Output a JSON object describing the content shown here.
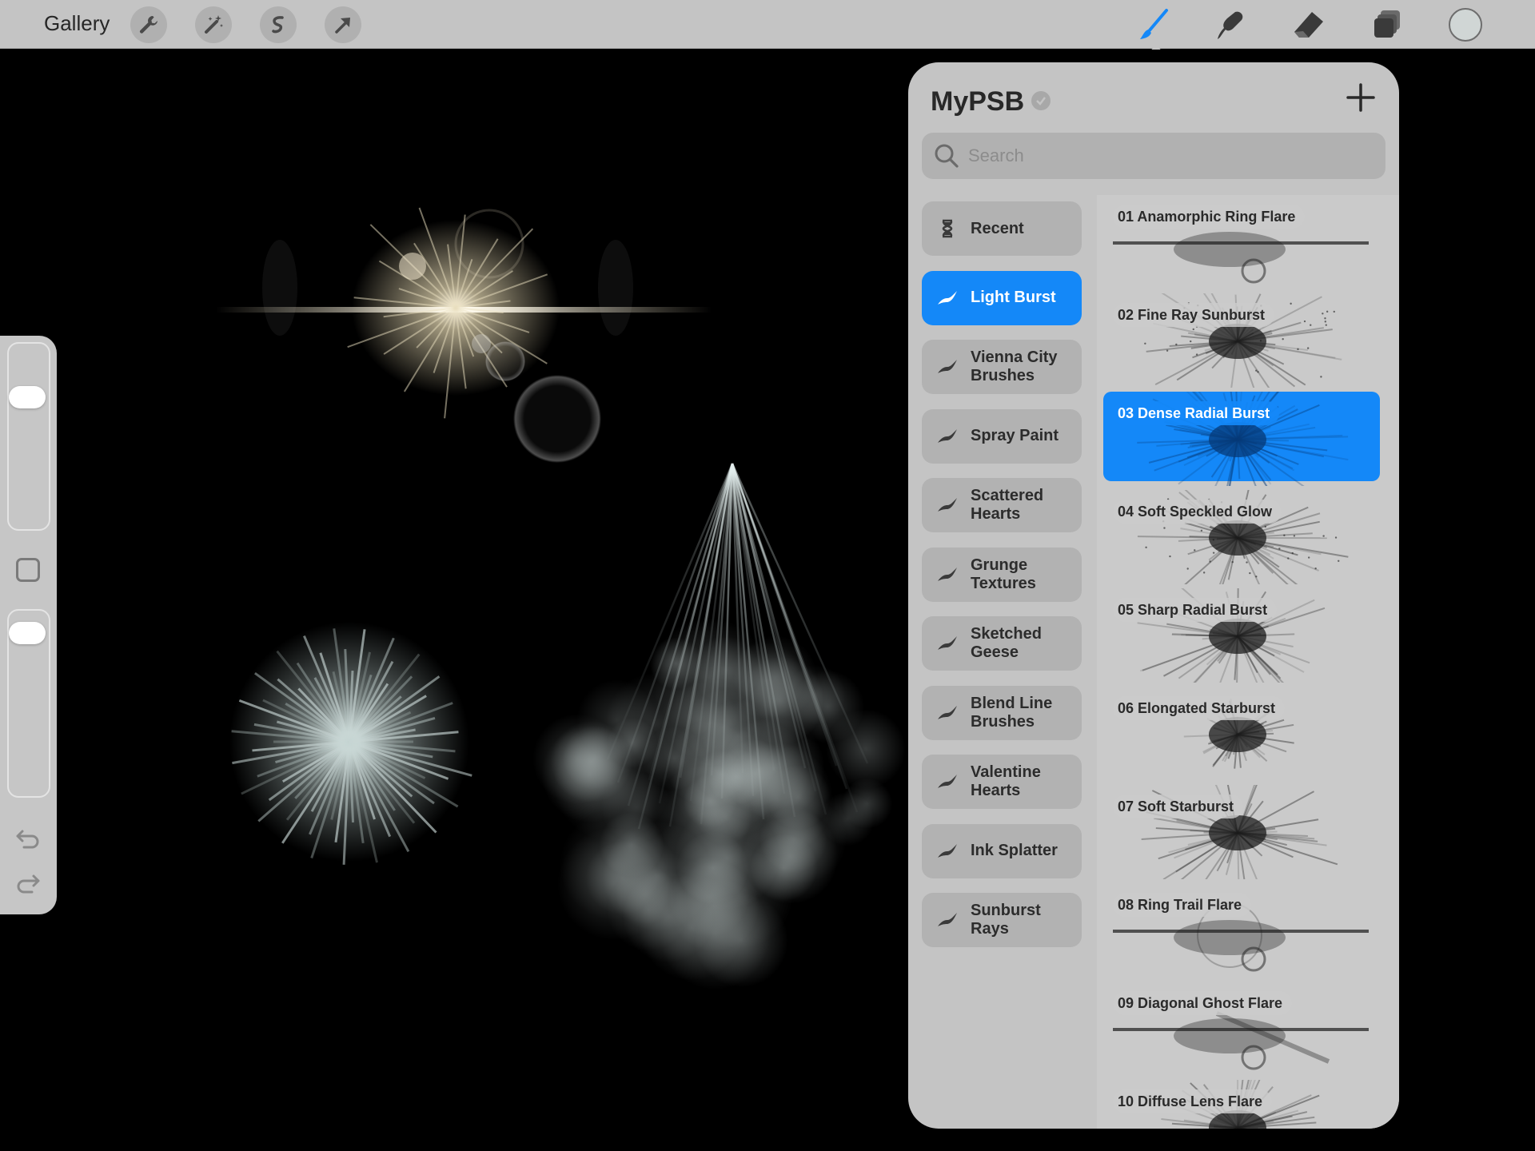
{
  "topbar": {
    "gallery_label": "Gallery",
    "left_tools": [
      "wrench-icon",
      "magic-wand-icon",
      "selection-icon",
      "transform-arrow-icon"
    ],
    "right_tools": [
      "brush-icon",
      "smudge-icon",
      "eraser-icon",
      "layers-icon"
    ],
    "active_tool": "brush-icon",
    "current_color": "#d0d6d5"
  },
  "sidebar": {
    "brush_size_level": 0.75,
    "opacity_level": 0.95
  },
  "library": {
    "title": "MyPSB",
    "search_placeholder": "Search",
    "sets": [
      {
        "label": "Recent",
        "icon": "hourglass-icon"
      },
      {
        "label": "Light Burst",
        "icon": "brush-stroke-icon",
        "active": true
      },
      {
        "label": "Vienna City\nBrushes",
        "icon": "brush-stroke-icon"
      },
      {
        "label": "Spray Paint",
        "icon": "brush-stroke-icon"
      },
      {
        "label": "Scattered\nHearts",
        "icon": "brush-stroke-icon"
      },
      {
        "label": "Grunge\nTextures",
        "icon": "brush-stroke-icon"
      },
      {
        "label": "Sketched\nGeese",
        "icon": "brush-stroke-icon"
      },
      {
        "label": "Blend Line\nBrushes",
        "icon": "brush-stroke-icon"
      },
      {
        "label": "Valentine\nHearts",
        "icon": "brush-stroke-icon"
      },
      {
        "label": "Ink Splatter",
        "icon": "brush-stroke-icon"
      },
      {
        "label": "Sunburst\nRays",
        "icon": "brush-stroke-icon"
      }
    ],
    "brushes": [
      {
        "name": "01 Anamorphic Ring Flare",
        "stroke": "ring-flare"
      },
      {
        "name": "02 Fine Ray Sunburst",
        "stroke": "fine-sunburst"
      },
      {
        "name": "03 Dense Radial Burst",
        "stroke": "dense-burst",
        "active": true
      },
      {
        "name": "04 Soft Speckled Glow",
        "stroke": "speckled-glow"
      },
      {
        "name": "05 Sharp Radial Burst",
        "stroke": "sharp-burst"
      },
      {
        "name": "06 Elongated Starburst",
        "stroke": "elongated-star"
      },
      {
        "name": "07 Soft Starburst",
        "stroke": "soft-star"
      },
      {
        "name": "08 Ring Trail Flare",
        "stroke": "ring-trail"
      },
      {
        "name": "09 Diagonal Ghost Flare",
        "stroke": "diagonal-ghost"
      },
      {
        "name": "10 Diffuse Lens Flare",
        "stroke": "diffuse-flare"
      }
    ],
    "colors": {
      "accent": "#1488f8",
      "panel": "#c4c4c4"
    }
  }
}
